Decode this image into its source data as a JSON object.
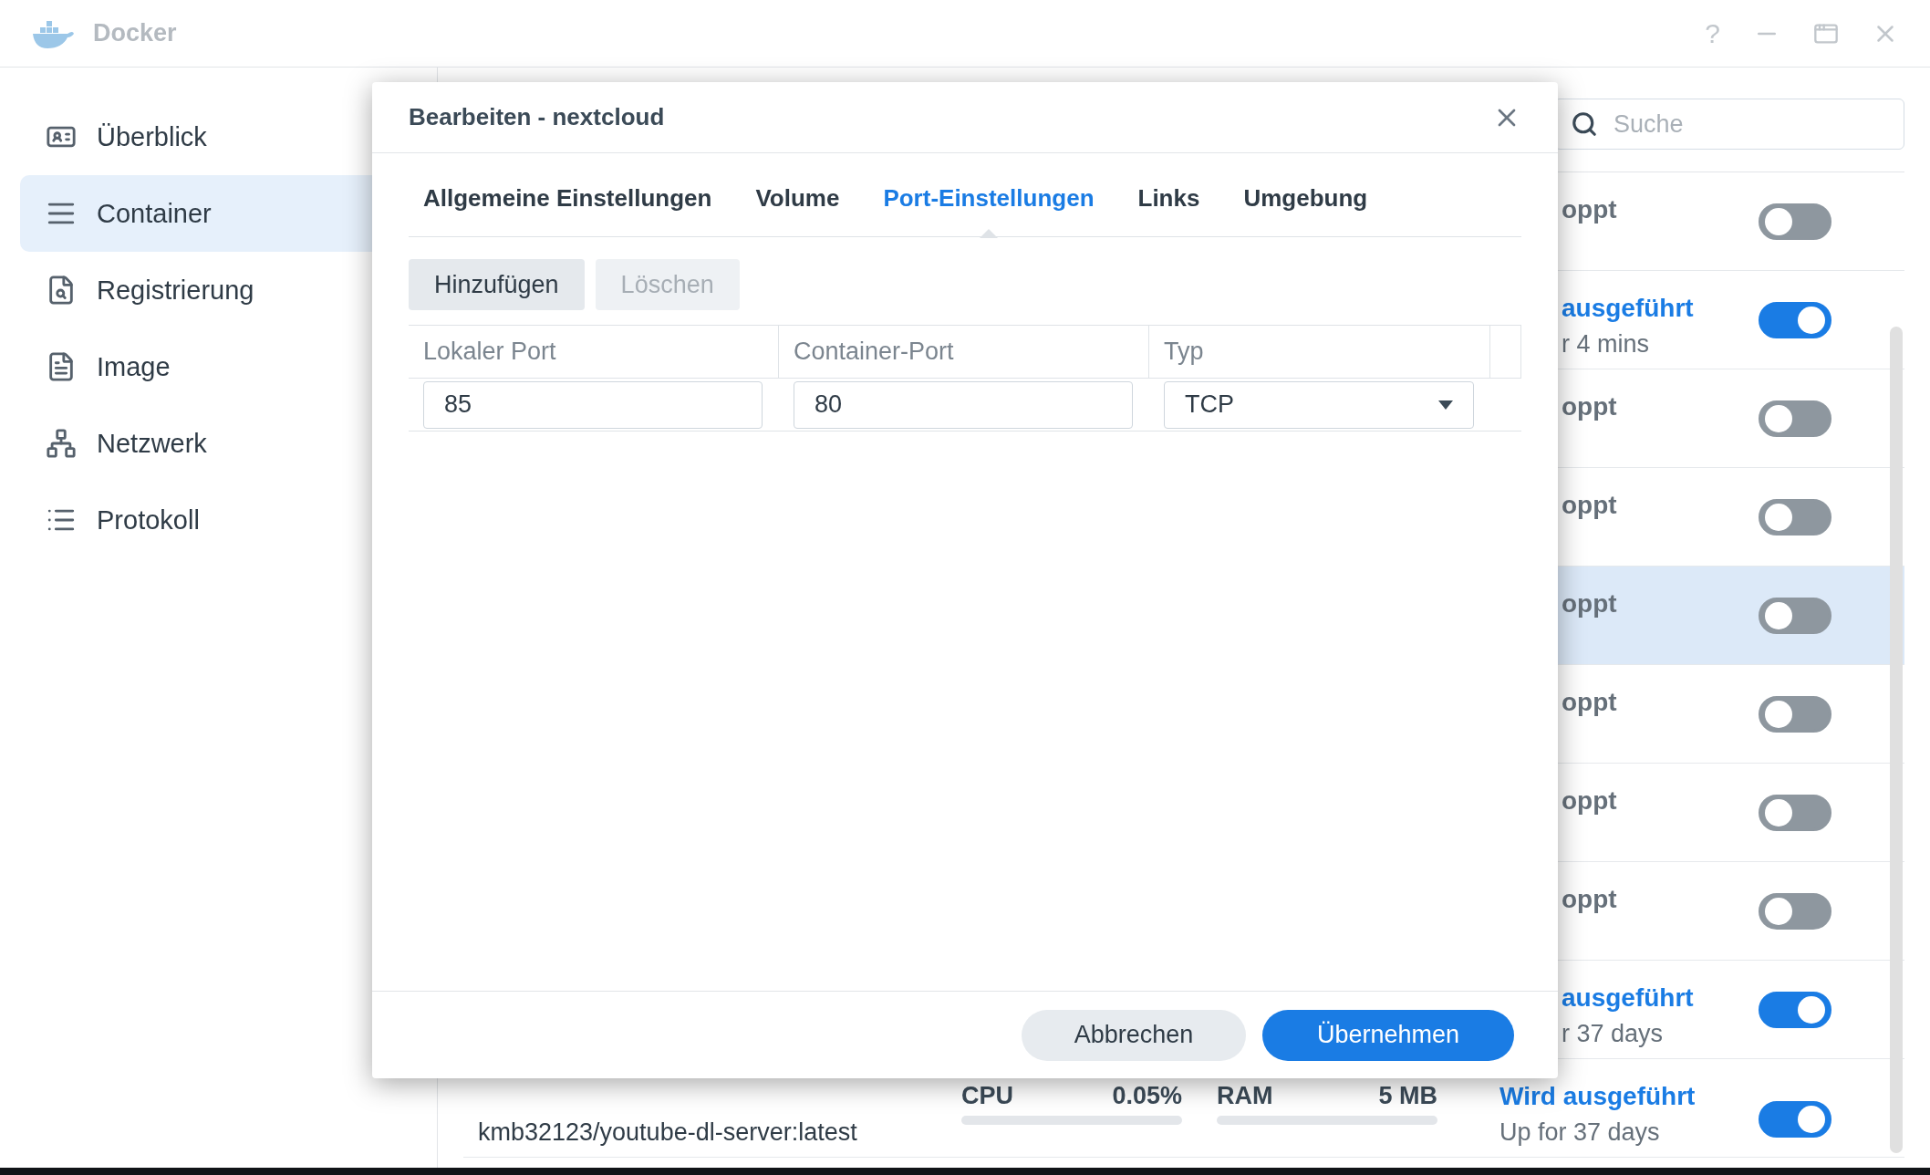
{
  "window": {
    "title": "Docker",
    "help_label": "?"
  },
  "sidebar": {
    "items": [
      {
        "label": "Überblick",
        "selected": false
      },
      {
        "label": "Container",
        "selected": true
      },
      {
        "label": "Registrierung",
        "selected": false
      },
      {
        "label": "Image",
        "selected": false
      },
      {
        "label": "Netzwerk",
        "selected": false
      },
      {
        "label": "Protokoll",
        "selected": false
      }
    ]
  },
  "search": {
    "placeholder": "Suche"
  },
  "container_list": {
    "rows": [
      {
        "status": "oppt",
        "on": false,
        "selected": false
      },
      {
        "status": "ausgeführt",
        "uptime": "r 4 mins",
        "on": true,
        "selected": false
      },
      {
        "status": "oppt",
        "on": false,
        "selected": false
      },
      {
        "status": "oppt",
        "on": false,
        "selected": false
      },
      {
        "status": "oppt",
        "on": false,
        "selected": true
      },
      {
        "status": "oppt",
        "on": false,
        "selected": false
      },
      {
        "status": "oppt",
        "on": false,
        "selected": false
      },
      {
        "status": "oppt",
        "on": false,
        "selected": false
      },
      {
        "status": "ausgeführt",
        "uptime": "r 37 days",
        "on": true,
        "selected": false
      },
      {
        "image": "kmb32123/youtube-dl-server:latest",
        "cpu": {
          "label": "CPU",
          "value": "0.05%",
          "level": 0
        },
        "ram": {
          "label": "RAM",
          "value": "5 MB",
          "level": 0
        },
        "status": "Wird ausgeführt",
        "uptime": "Up for 37 days",
        "on": true,
        "selected": false
      }
    ]
  },
  "dialog": {
    "title": "Bearbeiten - nextcloud",
    "tabs": [
      {
        "label": "Allgemeine Einstellungen",
        "selected": false
      },
      {
        "label": "Volume",
        "selected": false
      },
      {
        "label": "Port-Einstellungen",
        "selected": true
      },
      {
        "label": "Links",
        "selected": false
      },
      {
        "label": "Umgebung",
        "selected": false
      }
    ],
    "toolbar": [
      {
        "label": "Hinzufügen",
        "disabled": false
      },
      {
        "label": "Löschen",
        "disabled": true
      }
    ],
    "table": {
      "columns": [
        "Lokaler Port",
        "Container-Port",
        "Typ"
      ],
      "rows": [
        {
          "local_port": "85",
          "container_port": "80",
          "type": "TCP"
        }
      ]
    },
    "buttons": {
      "cancel": "Abbrechen",
      "apply": "Übernehmen"
    }
  }
}
